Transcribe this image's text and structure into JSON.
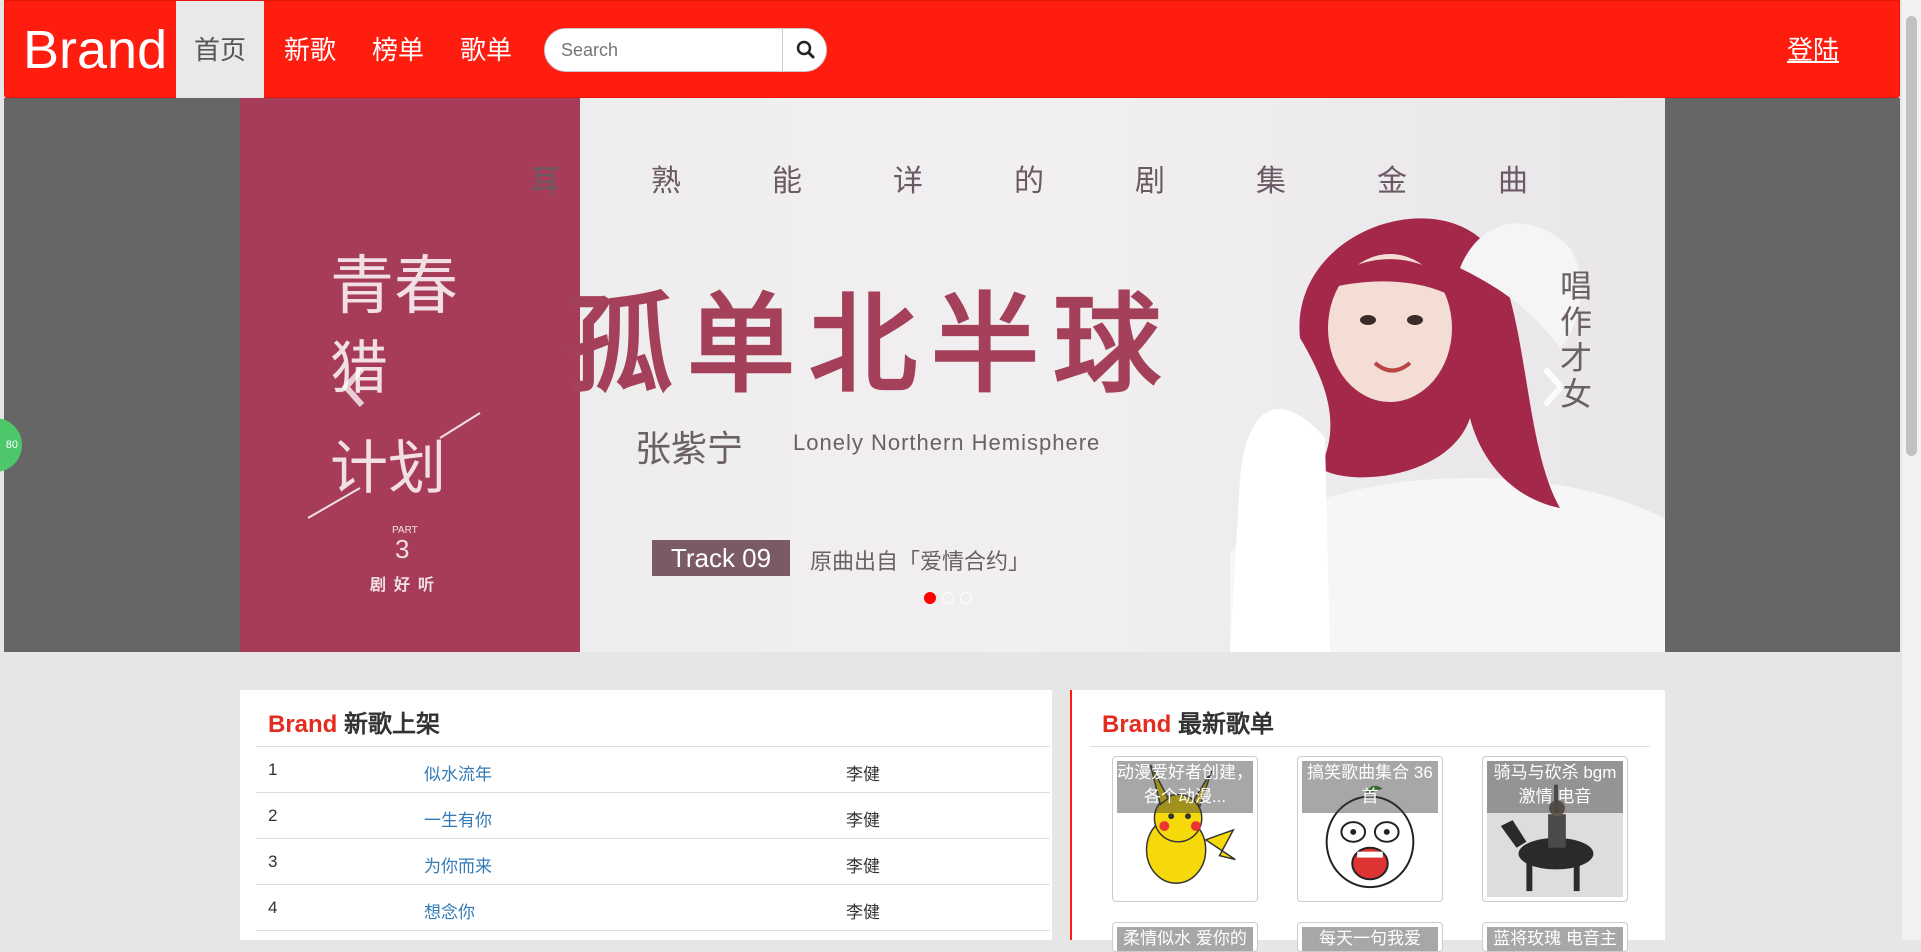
{
  "navbar": {
    "brand": "Brand",
    "items": [
      {
        "label": "首页",
        "active": true
      },
      {
        "label": "新歌",
        "active": false
      },
      {
        "label": "榜单",
        "active": false
      },
      {
        "label": "歌单",
        "active": false
      }
    ],
    "search_placeholder": "Search",
    "search_icon": "search-icon",
    "login": "登陆",
    "color": "#ff1d10"
  },
  "carousel": {
    "tagline_chars": [
      "耳",
      "熟",
      "能",
      "详",
      "的",
      "剧",
      "集",
      "金",
      "曲"
    ],
    "title": "孤单北半球",
    "singer": "张紫宁",
    "english_title": "Lonely Northern Hemisphere",
    "track": "Track 09",
    "origin": "原曲出自「爱情合约」",
    "side_text": "唱作才女",
    "left_art_text": "青春猎计划",
    "left_art_part": "PART",
    "left_art_num": "3",
    "left_art_sub": "剧好听",
    "slides": 3,
    "active_slide": 0
  },
  "badge": "80",
  "new_songs": {
    "brand": "Brand",
    "title": "新歌上架",
    "rows": [
      {
        "n": "1",
        "title": "似水流年",
        "artist": "李健"
      },
      {
        "n": "2",
        "title": "一生有你",
        "artist": "李健"
      },
      {
        "n": "3",
        "title": "为你而来",
        "artist": "李健"
      },
      {
        "n": "4",
        "title": "想念你",
        "artist": "李健"
      }
    ]
  },
  "playlists": {
    "brand": "Brand",
    "title": "最新歌单",
    "cards": [
      {
        "caption": "动漫爱好者创建，各个动漫..."
      },
      {
        "caption": "搞笑歌曲集合 36首"
      },
      {
        "caption": "骑马与砍杀 bgm 激情 电音"
      },
      {
        "caption": "柔情似水 爱你的"
      },
      {
        "caption": "每天一句我爱"
      },
      {
        "caption": "蓝将玫瑰 电音主"
      }
    ]
  }
}
